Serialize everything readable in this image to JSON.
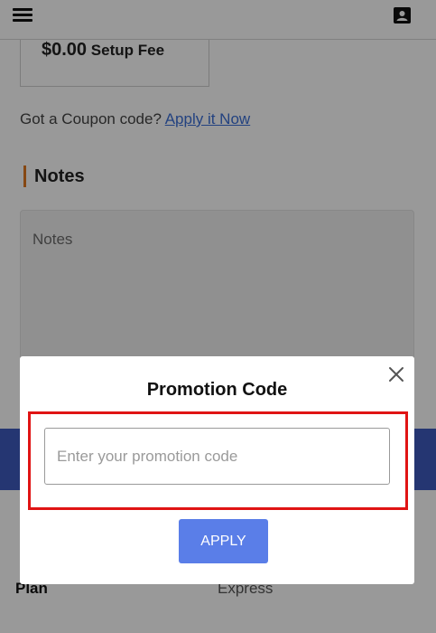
{
  "header": {
    "menu_icon": "hamburger-icon",
    "profile_icon": "contact-card-icon"
  },
  "fee": {
    "amount": "$0.00",
    "label": "Setup Fee"
  },
  "coupon": {
    "prompt": "Got a Coupon code?",
    "link": "Apply it Now"
  },
  "notes": {
    "heading": "Notes",
    "placeholder": "Notes",
    "accent_color": "#e07820"
  },
  "details": {
    "plan_label": "Plan",
    "plan_value": "Express"
  },
  "modal": {
    "title": "Promotion Code",
    "input_placeholder": "Enter your promotion code",
    "apply_label": "APPLY",
    "close_icon": "close-icon",
    "highlight_color": "#e01414",
    "button_color": "#5a7ee8"
  }
}
